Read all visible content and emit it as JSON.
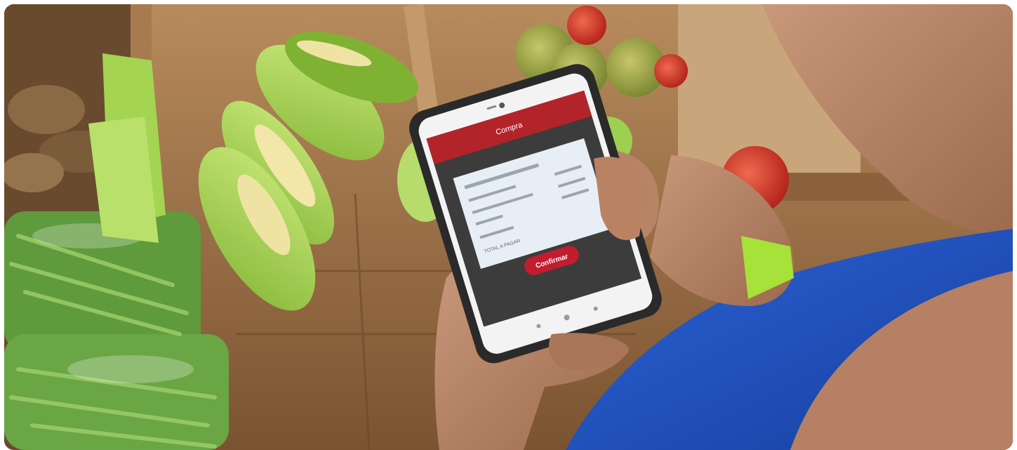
{
  "photo": {
    "subject": "farmers-market-produce-and-phone-payment",
    "colors": {
      "wood": "#9b6f45",
      "wood_dark": "#5a3a20",
      "corn_husk": "#9fce45",
      "corn_kernel": "#f2e6a8",
      "green_bean": "#6fa34a",
      "tomato": "#d9473a",
      "shirt_blue": "#1f55c7",
      "skin": "#b98262",
      "wristband": "#a6e23a",
      "phone_body": "#2a2a2a",
      "phone_header": "#b3242a",
      "screen_card": "#e8eef5",
      "confirm_button": "#c21d2f"
    }
  },
  "phone_screen": {
    "header_title": "Compra",
    "confirm_label": "Confirmar",
    "total_label": "TOTAL A PAGAR"
  }
}
